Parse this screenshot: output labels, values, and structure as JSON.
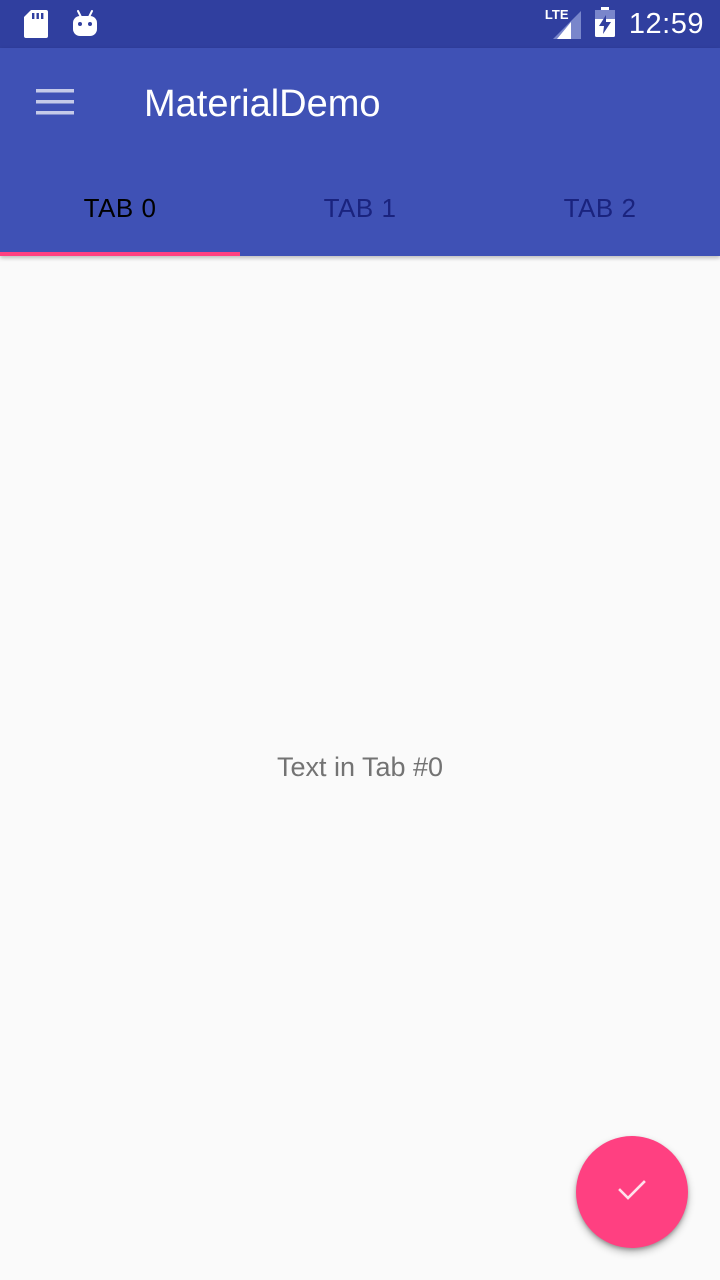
{
  "status_bar": {
    "time": "12:59",
    "network_label": "LTE",
    "left_icons": [
      "sd-card-icon",
      "android-icon"
    ],
    "right_icons": [
      "signal-icon",
      "battery-charging-icon"
    ]
  },
  "app_bar": {
    "title": "MaterialDemo",
    "menu_icon": "hamburger-menu-icon",
    "background_color": "#3f51b5",
    "status_bar_color": "#303f9f"
  },
  "tabs": {
    "items": [
      {
        "label": "TAB 0",
        "selected": true
      },
      {
        "label": "TAB 1",
        "selected": false
      },
      {
        "label": "TAB 2",
        "selected": false
      }
    ],
    "indicator_color": "#ff4081"
  },
  "content": {
    "text": "Text in Tab #0"
  },
  "fab": {
    "icon": "check-icon",
    "color": "#ff4081"
  }
}
